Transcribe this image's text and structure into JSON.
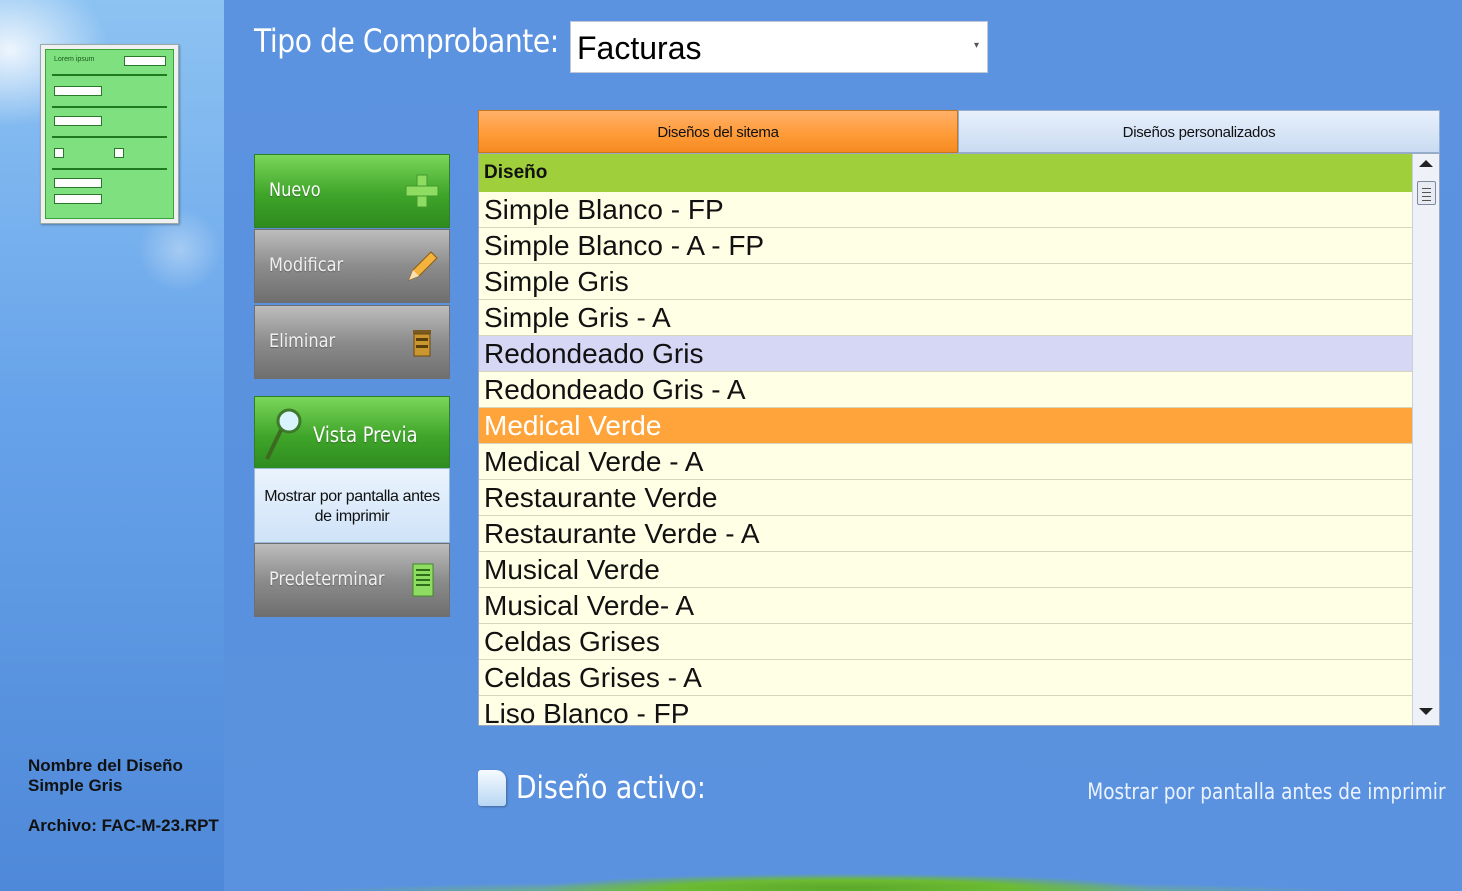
{
  "tipo": {
    "label": "Tipo de Comprobante:",
    "value": "Facturas"
  },
  "thumbnail": {
    "title": "Lorem ipsum"
  },
  "buttons": {
    "nuevo": "Nuevo",
    "modificar": "Modificar",
    "eliminar": "Eliminar",
    "vista_previa": "Vista Previa",
    "mostrar_pantalla": "Mostrar por pantalla antes de imprimir",
    "predeterminar": "Predeterminar"
  },
  "tabs": [
    {
      "label": "Diseños del sitema",
      "active": true
    },
    {
      "label": "Diseños personalizados",
      "active": false
    }
  ],
  "grid": {
    "header": "Diseño",
    "rows": [
      "Simple Blanco - FP",
      "Simple Blanco - A - FP",
      "Simple Gris",
      "Simple Gris - A",
      "Redondeado Gris",
      "Redondeado Gris - A",
      "Medical Verde",
      "Medical Verde - A",
      "Restaurante Verde",
      "Restaurante Verde - A",
      "Musical Verde",
      "Musical Verde- A",
      "Celdas Grises",
      "Celdas Grises - A",
      "Liso Blanco - FP"
    ],
    "hover_index": 4,
    "selected_index": 6
  },
  "info": {
    "nombre": "Nombre del Diseño Simple Gris",
    "archivo": "Archivo: FAC-M-23.RPT"
  },
  "footer": {
    "activo_label": "Diseño activo:",
    "mostrar_right": "Mostrar por pantalla antes de imprimir"
  },
  "colors": {
    "background": "#5b92df",
    "tab_active": "#ff9a36",
    "header_green": "#9fcf3b",
    "row_bg": "#ffffe6",
    "row_selected": "#ffa43a",
    "row_hover": "#d6d6f5"
  }
}
